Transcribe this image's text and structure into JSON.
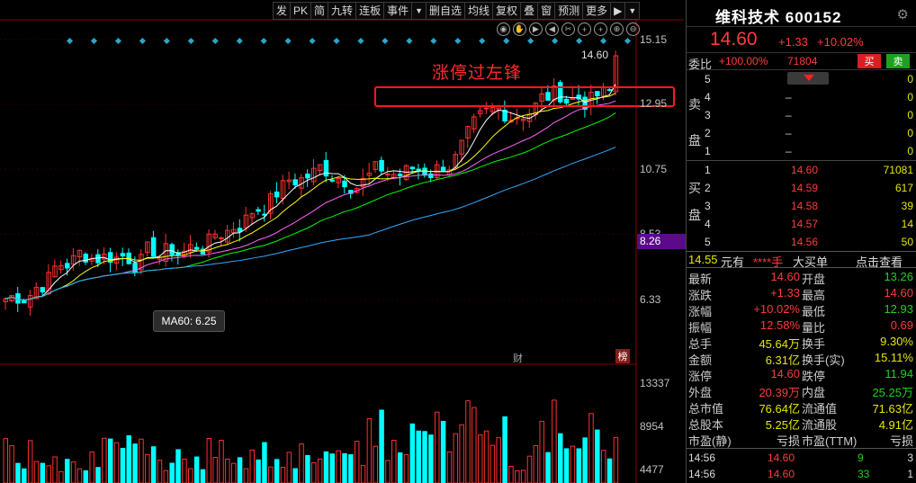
{
  "toolbar": {
    "items": [
      "发",
      "PK",
      "简",
      "九转",
      "连板",
      "事件",
      "▼",
      "删自选",
      "均线",
      "复权",
      "叠",
      "窗",
      "预测",
      "更多",
      "▶",
      "▼"
    ]
  },
  "chart": {
    "annotation": "涨停过左锋",
    "high_price_tag": "14.60",
    "ma_tooltip_label": "MA60:",
    "ma_tooltip_value": "6.25",
    "axis_labels": [
      "15.15",
      "12.95",
      "10.75",
      "8.53",
      "6.33"
    ],
    "axis_highlight": "8.26",
    "volume_axis_labels": [
      "13337",
      "8954",
      "4477"
    ],
    "mark_finance": "财",
    "mark_list": "榜",
    "colors": {
      "up": "#ff3030",
      "down": "#00ffff",
      "ma5": "#ffffff",
      "ma10": "#ffff00",
      "ma20": "#ff66ff",
      "ma30": "#00ff00",
      "ma60": "#33aaff"
    }
  },
  "panel": {
    "name": "维科技术",
    "code": "600152",
    "price": "14.60",
    "change": "+1.33",
    "change_pct": "+10.02%",
    "weibi_label": "委比",
    "weibi_value": "+100.00%",
    "weibi_volume": "71804",
    "sell_button": "买",
    "buy_button": "卖",
    "sell_side_label": [
      "卖",
      "盘"
    ],
    "buy_side_label": [
      "买",
      "盘"
    ],
    "asks": [
      {
        "level": "5",
        "price": "",
        "qty": "0"
      },
      {
        "level": "4",
        "price": "–",
        "qty": "0"
      },
      {
        "level": "3",
        "price": "–",
        "qty": "0"
      },
      {
        "level": "2",
        "price": "–",
        "qty": "0"
      },
      {
        "level": "1",
        "price": "–",
        "qty": "0"
      }
    ],
    "bids": [
      {
        "level": "1",
        "price": "14.60",
        "qty": "71081"
      },
      {
        "level": "2",
        "price": "14.59",
        "qty": "617"
      },
      {
        "level": "3",
        "price": "14.58",
        "qty": "39"
      },
      {
        "level": "4",
        "price": "14.57",
        "qty": "14"
      },
      {
        "level": "5",
        "price": "14.56",
        "qty": "50"
      }
    ],
    "info_bar": {
      "price": "14.55",
      "unit": "元有",
      "stars": "****手",
      "big_buy": "大买单",
      "link": "点击查看"
    },
    "stats": [
      {
        "k1": "最新",
        "v1": "14.60",
        "c1": "red",
        "k2": "开盘",
        "v2": "13.26",
        "c2": "green"
      },
      {
        "k1": "涨跌",
        "v1": "+1.33",
        "c1": "red",
        "k2": "最高",
        "v2": "14.60",
        "c2": "red"
      },
      {
        "k1": "涨幅",
        "v1": "+10.02%",
        "c1": "red",
        "k2": "最低",
        "v2": "12.93",
        "c2": "green"
      },
      {
        "k1": "振幅",
        "v1": "12.58%",
        "c1": "red",
        "k2": "量比",
        "v2": "0.69",
        "c2": "red"
      },
      {
        "k1": "总手",
        "v1": "45.64万",
        "c1": "yellow",
        "k2": "换手",
        "v2": "9.30%",
        "c2": "yellow"
      },
      {
        "k1": "金额",
        "v1": "6.31亿",
        "c1": "yellow",
        "k2": "换手(实)",
        "v2": "15.11%",
        "c2": "yellow"
      },
      {
        "k1": "涨停",
        "v1": "14.60",
        "c1": "red",
        "k2": "跌停",
        "v2": "11.94",
        "c2": "green"
      },
      {
        "k1": "外盘",
        "v1": "20.39万",
        "c1": "red",
        "k2": "内盘",
        "v2": "25.25万",
        "c2": "green"
      },
      {
        "k1": "总市值",
        "v1": "76.64亿",
        "c1": "yellow",
        "k2": "流通值",
        "v2": "71.63亿",
        "c2": "yellow"
      },
      {
        "k1": "总股本",
        "v1": "5.25亿",
        "c1": "yellow",
        "k2": "流通股",
        "v2": "4.91亿",
        "c2": "yellow"
      },
      {
        "k1": "市盈(静)",
        "v1": "亏损",
        "c1": "white",
        "k2": "市盈(TTM)",
        "v2": "亏损",
        "c2": "white"
      }
    ],
    "ticks": [
      {
        "time": "14:56",
        "price": "14.60",
        "vol": "9",
        "n": "3"
      },
      {
        "time": "14:56",
        "price": "14.60",
        "vol": "33",
        "n": "1"
      }
    ]
  }
}
